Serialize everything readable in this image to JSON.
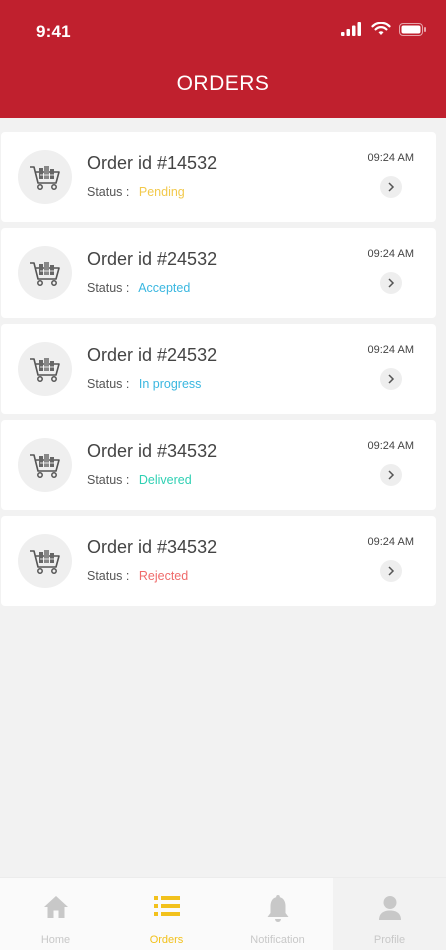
{
  "status_bar": {
    "time": "9:41"
  },
  "header": {
    "title": "ORDERS"
  },
  "status_prefix": "Status :",
  "orders": [
    {
      "title": "Order id #14532",
      "status": "Pending",
      "status_color": "#f2c94c",
      "time": "09:24 AM"
    },
    {
      "title": "Order id #24532",
      "status": "Accepted",
      "status_color": "#3ab7e0",
      "time": "09:24 AM"
    },
    {
      "title": "Order id #24532",
      "status": "In progress",
      "status_color": "#3ab7e0",
      "time": "09:24 AM"
    },
    {
      "title": "Order id #34532",
      "status": "Delivered",
      "status_color": "#2fd0b3",
      "time": "09:24 AM"
    },
    {
      "title": "Order id #34532",
      "status": "Rejected",
      "status_color": "#ef6b6b",
      "time": "09:24 AM"
    }
  ],
  "tabs": [
    {
      "label": "Home",
      "icon": "home-icon"
    },
    {
      "label": "Orders",
      "icon": "list-icon"
    },
    {
      "label": "Notification",
      "icon": "bell-icon"
    },
    {
      "label": "Profile",
      "icon": "user-icon"
    }
  ],
  "colors": {
    "brand": "#c0202e",
    "active_tab": "#f2c11c"
  }
}
